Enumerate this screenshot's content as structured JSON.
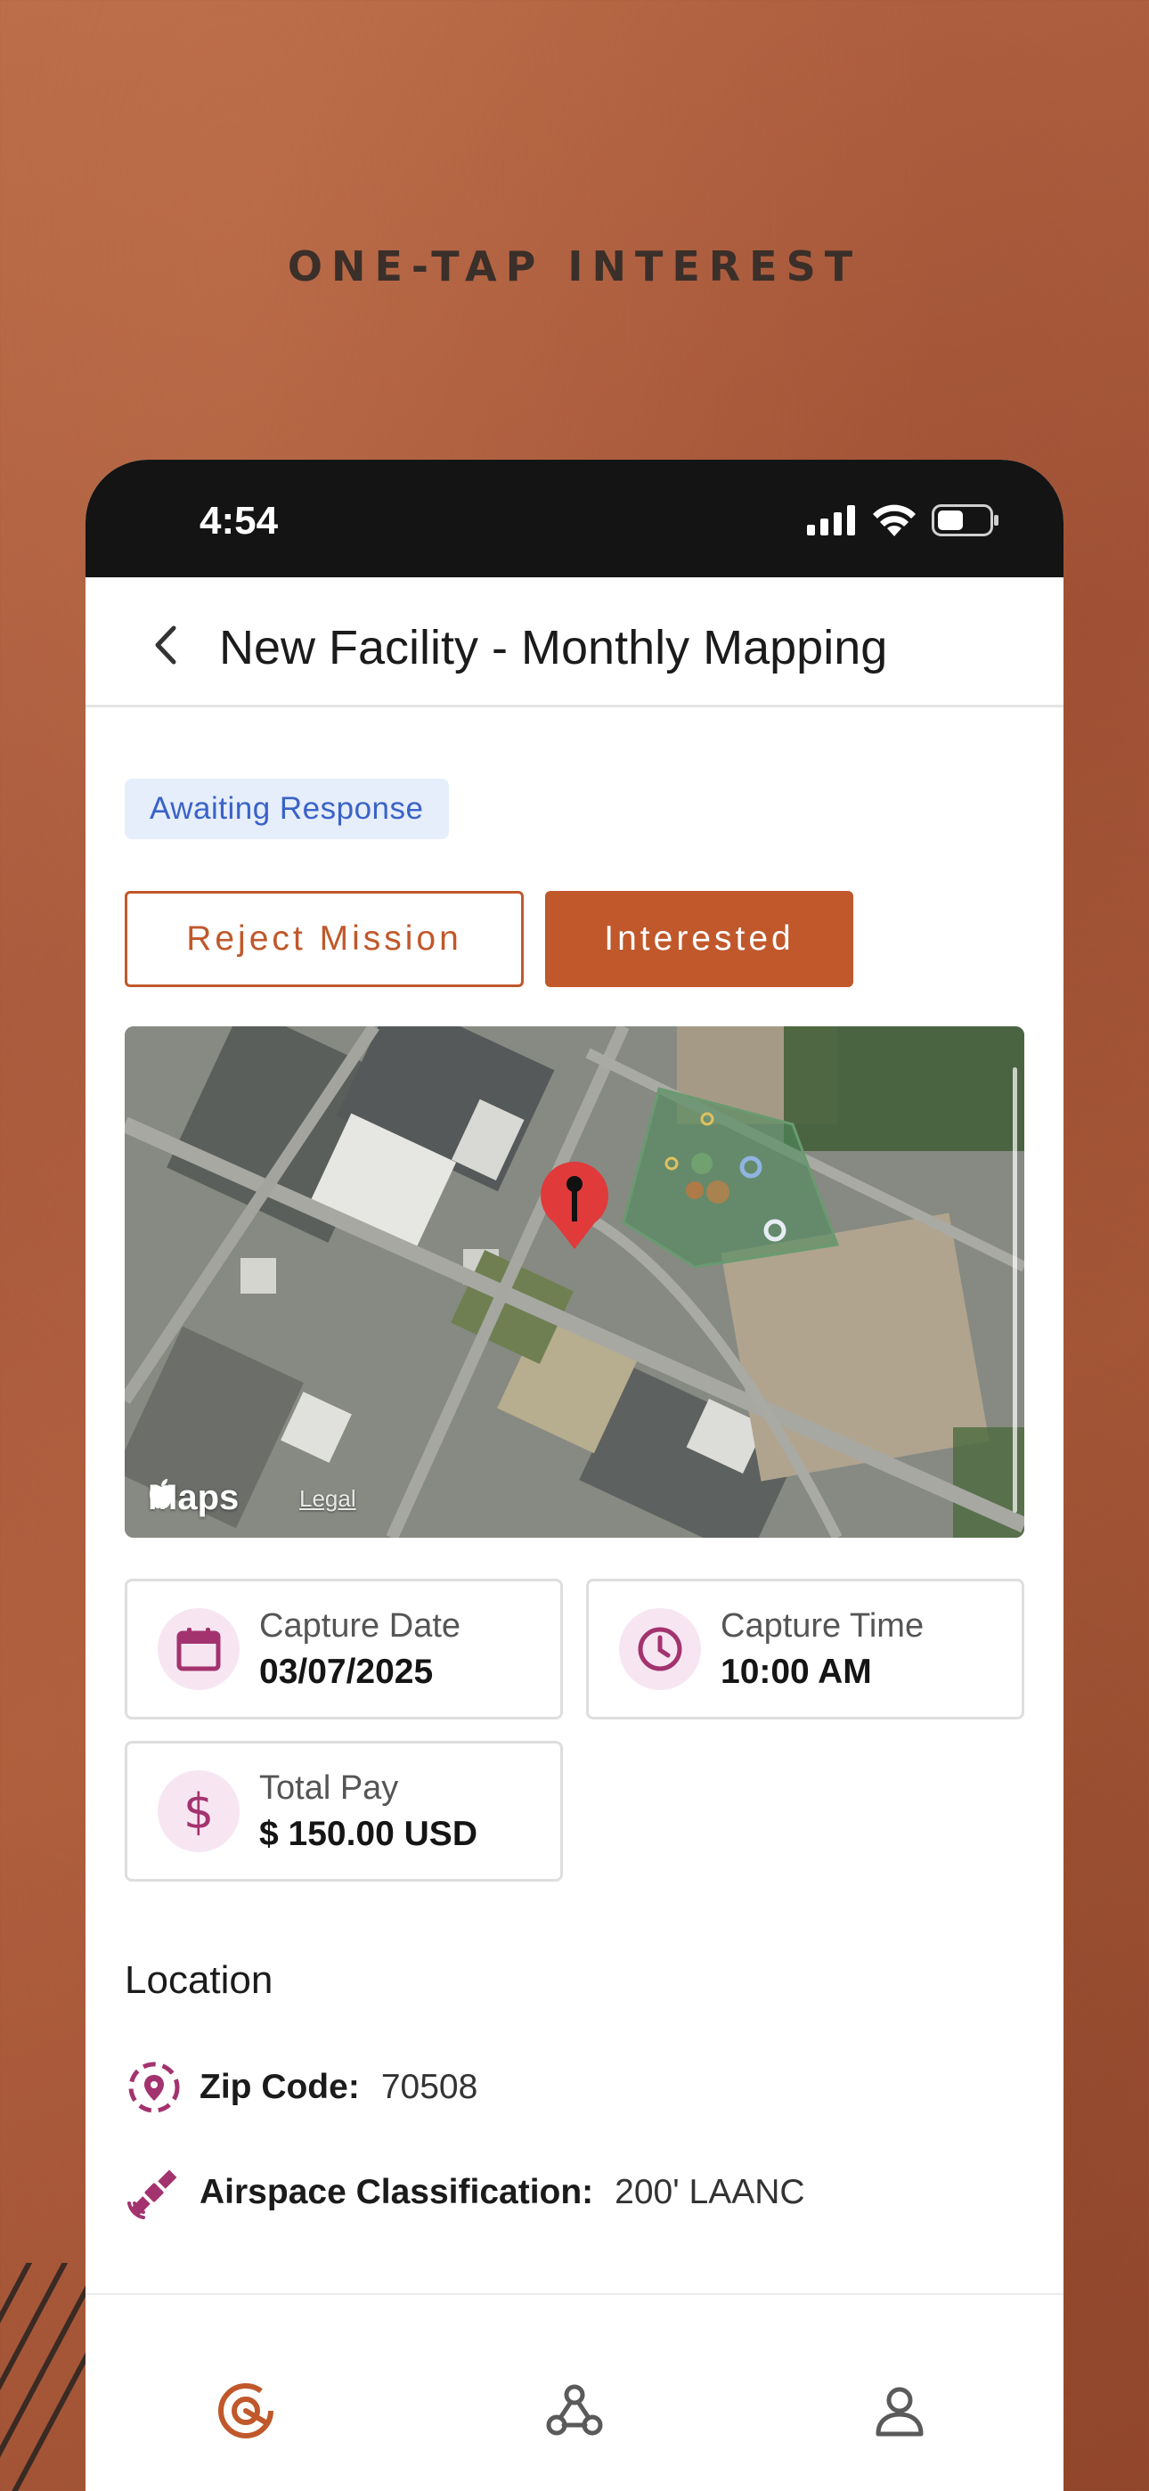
{
  "marketing": {
    "title": "ONE-TAP INTEREST"
  },
  "status_bar": {
    "time": "4:54"
  },
  "header": {
    "title": "New Facility - Monthly Mapping"
  },
  "mission": {
    "status": "Awaiting Response",
    "reject_label": "Reject Mission",
    "interested_label": "Interested"
  },
  "map": {
    "brand": "Maps",
    "legal": "Legal"
  },
  "details": {
    "capture_date": {
      "label": "Capture Date",
      "value": "03/07/2025"
    },
    "capture_time": {
      "label": "Capture Time",
      "value": "10:00 AM"
    },
    "total_pay": {
      "label": "Total Pay",
      "value": "$ 150.00 USD"
    }
  },
  "location": {
    "title": "Location",
    "zip": {
      "label": "Zip Code:",
      "value": "70508"
    },
    "airspace": {
      "label": "Airspace Classification:",
      "value": "200' LAANC"
    }
  },
  "colors": {
    "accent": "#c0582b",
    "icon": "#a3336e",
    "badge_bg": "#e6eefc",
    "badge_text": "#3a63c7"
  },
  "tabs": [
    "target-icon",
    "webhook-icon",
    "profile-icon"
  ]
}
